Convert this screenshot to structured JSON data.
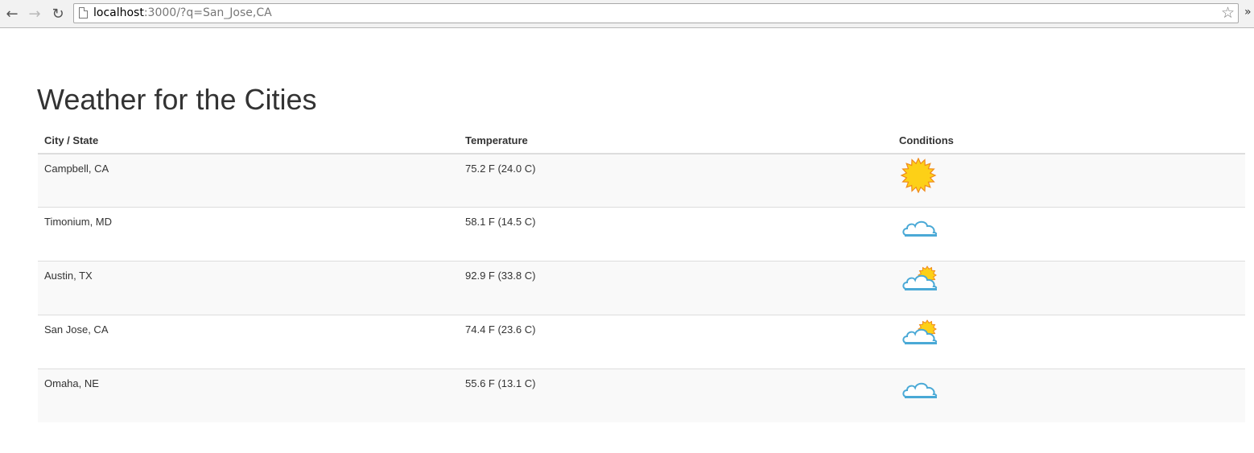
{
  "browser": {
    "url_host": "localhost",
    "url_rest": ":3000/?q=San_Jose,CA",
    "overflow_label": "»"
  },
  "page": {
    "title": "Weather for the Cities"
  },
  "table": {
    "headers": [
      "City / State",
      "Temperature",
      "Conditions"
    ],
    "rows": [
      {
        "city": "Campbell, CA",
        "temperature": "75.2 F (24.0 C)",
        "condition": "sunny-icon"
      },
      {
        "city": "Timonium, MD",
        "temperature": "58.1 F (14.5 C)",
        "condition": "cloudy-icon"
      },
      {
        "city": "Austin, TX",
        "temperature": "92.9 F (33.8 C)",
        "condition": "partly-sunny-icon"
      },
      {
        "city": "San Jose, CA",
        "temperature": "74.4 F (23.6 C)",
        "condition": "partly-sunny-icon"
      },
      {
        "city": "Omaha, NE",
        "temperature": "55.6 F (13.1 C)",
        "condition": "cloudy-icon"
      }
    ]
  },
  "colors": {
    "sun_fill": "#fdd017",
    "sun_stroke": "#f08a1c",
    "cloud_stroke": "#4aa9d6"
  }
}
